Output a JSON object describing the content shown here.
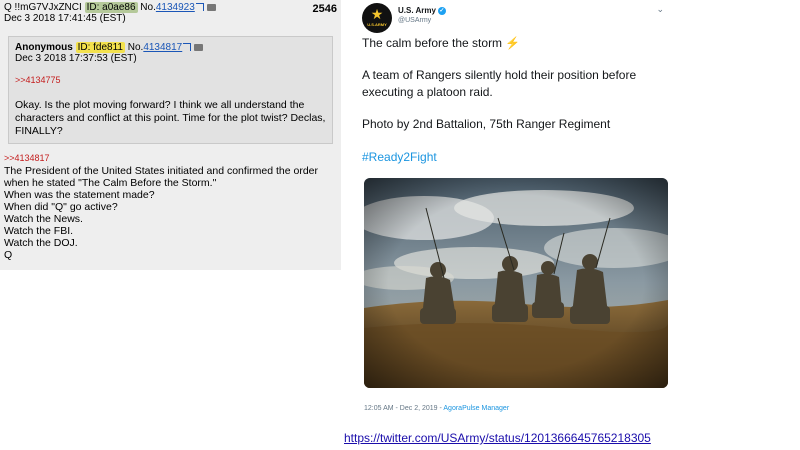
{
  "qpost": {
    "name": "Q !!mG7VJxZNCI",
    "id_label": "ID: a0ae86",
    "num_prefix": "No.",
    "num": "4134923",
    "date": "Dec 3 2018 17:41:45 (EST)",
    "post_count": "2546",
    "reply": {
      "name": "Anonymous",
      "id_label": "ID: fde811",
      "num_prefix": "No.",
      "num": "4134817",
      "date": "Dec 3 2018 17:37:53 (EST)",
      "quote": ">>4134775",
      "body": "Okay. Is the plot moving forward? I think we all understand the characters and conflict at this point. Time for the plot twist? Declas, FINALLY?"
    },
    "quote": ">>4134817",
    "lines": [
      "The President of the United States initiated and confirmed the order",
      "when he stated \"The Calm Before the Storm.\"",
      "When was the statement made?",
      "When did \"Q\" go active?",
      "Watch the News.",
      "Watch the FBI.",
      "Watch the DOJ.",
      "Q"
    ]
  },
  "tweet": {
    "display_name": "U.S. Army",
    "handle": "@USArmy",
    "avatar_text": "U.S.ARMY",
    "text1": "The calm before the storm",
    "bolt": "⚡",
    "text2_line1": "A team of Rangers silently hold their position before",
    "text2_line2": "executing a platoon raid.",
    "text3": "Photo by 2nd Battalion, 75th Ranger Regiment",
    "hashtag": "#Ready2Fight",
    "meta_time": "12:05 AM - Dec 2, 2019 - ",
    "meta_source": "AgoraPulse Manager"
  },
  "url": "https://twitter.com/USArmy/status/1201366645765218305",
  "colors": {
    "post_bg": "#eeeeee",
    "reply_bg": "#e2e2e2",
    "quote_red": "#c41e1e",
    "link_blue": "#1a56b7",
    "twitter_blue": "#1b95e0"
  }
}
